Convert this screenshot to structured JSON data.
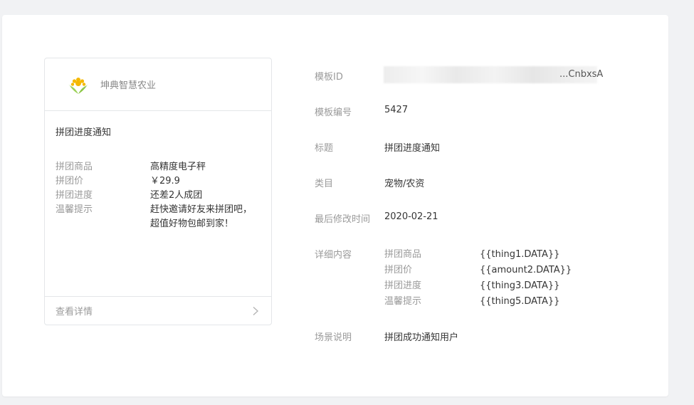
{
  "preview": {
    "brand": "坤典智慧农业",
    "title": "拼团进度通知",
    "rows": [
      {
        "key": "拼团商品",
        "value": "高精度电子秤"
      },
      {
        "key": "拼团价",
        "value": "￥29.9"
      },
      {
        "key": "拼团进度",
        "value": "还差2人成团"
      },
      {
        "key": "温馨提示",
        "value": "赶快邀请好友来拼团吧，",
        "value2": "超值好物包邮到家！"
      }
    ],
    "footer": "查看详情"
  },
  "info": {
    "template_id_label": "模板ID",
    "template_id_visible": "...CnbxsA",
    "template_no_label": "模板编号",
    "template_no": "5427",
    "title_label": "标题",
    "title": "拼团进度通知",
    "category_label": "类目",
    "category": "宠物/农资",
    "modified_label": "最后修改时间",
    "modified": "2020-02-21",
    "detail_label": "详细内容",
    "detail_rows": [
      {
        "key": "拼团商品",
        "value": "{{thing1.DATA}}"
      },
      {
        "key": "拼团价",
        "value": "{{amount2.DATA}}"
      },
      {
        "key": "拼团进度",
        "value": "{{thing3.DATA}}"
      },
      {
        "key": "温馨提示",
        "value": "{{thing5.DATA}}"
      }
    ],
    "scene_label": "场景说明",
    "scene": "拼团成功通知用户"
  },
  "colors": {
    "label": "#9a9a9a",
    "text": "#353535",
    "border": "#e4e6e9",
    "logo_petal": "#f5b800",
    "logo_leaf": "#7cbf3d"
  }
}
